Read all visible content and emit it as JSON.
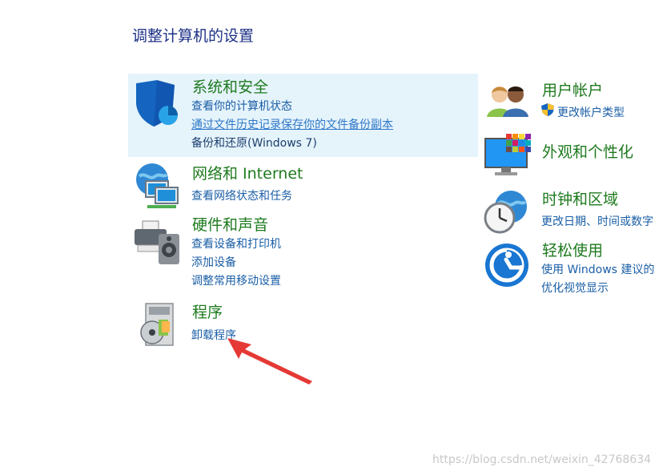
{
  "page": {
    "title": "调整计算机的设置"
  },
  "left": [
    {
      "title": "系统和安全",
      "icon": "shield-icon",
      "links": [
        "查看你的计算机状态",
        "通过文件历史记录保存你的文件备份副本",
        "备份和还原(Windows 7)"
      ]
    },
    {
      "title": "网络和 Internet",
      "icon": "network-globe-icon",
      "links": [
        "查看网络状态和任务"
      ]
    },
    {
      "title": "硬件和声音",
      "icon": "printer-speaker-icon",
      "links": [
        "查看设备和打印机",
        "添加设备",
        "调整常用移动设置"
      ]
    },
    {
      "title": "程序",
      "icon": "programs-disc-icon",
      "links": [
        "卸载程序"
      ]
    }
  ],
  "right": [
    {
      "title": "用户帐户",
      "icon": "users-icon",
      "links": [
        "更改帐户类型"
      ]
    },
    {
      "title": "外观和个性化",
      "icon": "monitor-palette-icon",
      "links": []
    },
    {
      "title": "时钟和区域",
      "icon": "clock-globe-icon",
      "links": [
        "更改日期、时间或数字"
      ]
    },
    {
      "title": "轻松使用",
      "icon": "ease-of-access-icon",
      "links": [
        "使用 Windows 建议的",
        "优化视觉显示"
      ]
    }
  ],
  "watermark": "https://blog.csdn.net/weixin_42768634",
  "colors": {
    "title": "#1e3287",
    "category": "#1e7a1e",
    "link": "#1a5ea6",
    "highlight": "#e5f3fb",
    "arrow": "#e53935"
  }
}
